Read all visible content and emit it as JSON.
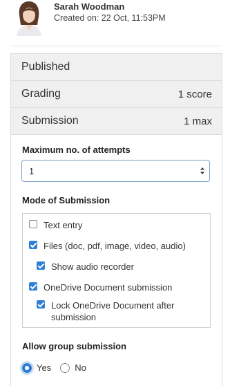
{
  "author": {
    "name": "Sarah Woodman",
    "created": "Created on: 22 Oct, 11:53PM"
  },
  "status_rows": [
    {
      "label": "Published",
      "value": ""
    },
    {
      "label": "Grading",
      "value": "1 score"
    },
    {
      "label": "Submission",
      "value": "1 max"
    }
  ],
  "attempts": {
    "title": "Maximum no. of attempts",
    "selected": "1"
  },
  "mode": {
    "title": "Mode of Submission",
    "options": [
      {
        "label": "Text entry",
        "checked": false
      },
      {
        "label": "Files (doc, pdf, image, video, audio)",
        "checked": true
      },
      {
        "label": "Show audio recorder",
        "checked": true
      },
      {
        "label": "OneDrive Document submission",
        "checked": true
      },
      {
        "label": "Lock OneDrive Document after submission",
        "checked": true
      }
    ]
  },
  "group": {
    "title": "Allow group submission",
    "options": [
      {
        "label": "Yes",
        "selected": true
      },
      {
        "label": "No",
        "selected": false
      }
    ]
  },
  "colors": {
    "accent": "#2f7fd6",
    "row_bg": "#f0f0f0"
  }
}
